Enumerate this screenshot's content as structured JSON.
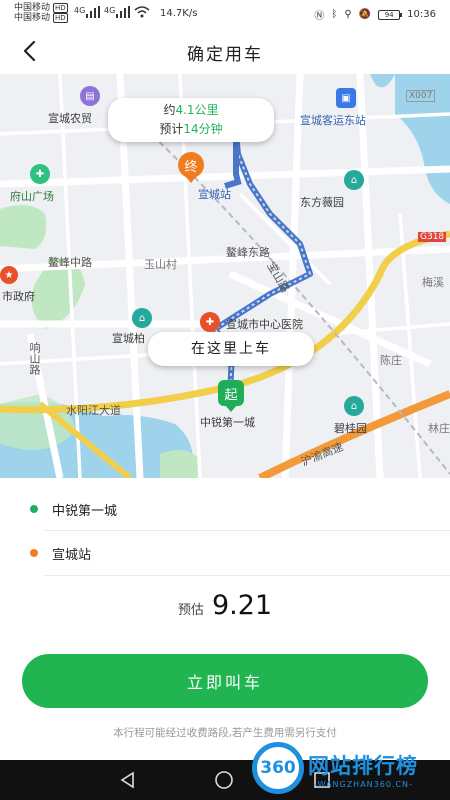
{
  "status_bar": {
    "carrier1": "中国移动",
    "carrier2": "中国移动",
    "hd": "HD",
    "net": "4G",
    "speed": "14.7K/s",
    "battery": "94",
    "time": "10:36"
  },
  "header": {
    "title": "确定用车"
  },
  "map": {
    "trip_bubble": {
      "distance_prefix": "约",
      "distance": "4.1公里",
      "eta_prefix": "预计",
      "eta": "14分钟"
    },
    "board_bubble": "在这里上车",
    "end_pin": "终",
    "start_pin": "起",
    "labels": {
      "poi_market": "宣城农贸",
      "poi_bus": "宣城客运东站",
      "road_x007": "X007",
      "poi_plaza": "府山广场",
      "poi_station": "宣城站",
      "poi_dongfang": "东方薇园",
      "road_aofeng_e": "鳌峰东路",
      "road_aofeng_m": "鳌峰中路",
      "village_yushan": "玉山村",
      "road_yushan": "宝山路",
      "road_g318": "G318",
      "poi_meixi": "梅溪",
      "poi_gov": "市政府",
      "poi_hospital": "宣城市中心医院",
      "poi_binjiang": "宣城柏",
      "road_xiangshan": "响山路",
      "village_chenzhuang": "陈庄",
      "road_shuiyang": "水阳江大道",
      "poi_zhongrui": "中锐第一城",
      "poi_biguiyuan": "碧桂园",
      "road_highway": "沪渝高速",
      "village_linzhuang": "林庄"
    }
  },
  "route": {
    "start": "中锐第一城",
    "end": "宣城站"
  },
  "price": {
    "label": "预估",
    "value": "9.21"
  },
  "cta": "立即叫车",
  "notice": "本行程可能经过收费路段,若产生费用需另行支付",
  "watermark": {
    "badge": "360",
    "text": "网站排行榜",
    "sub": "-WANGZHAN360.CN-"
  },
  "colors": {
    "accent": "#20b550",
    "start_dot": "#1fae57",
    "end_dot": "#f07c22",
    "route": "#4a76c8"
  }
}
